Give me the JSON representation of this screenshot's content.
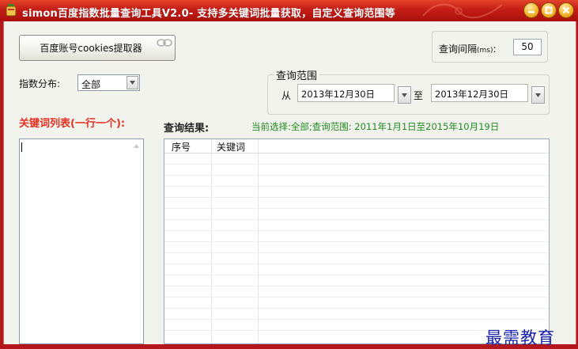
{
  "window": {
    "title": "simon百度指数批量查询工具V2.0- 支持多关键词批量获取，自定义查询范围等",
    "icons": {
      "app": "app-icon",
      "minimize": "minimize-icon",
      "maximize": "maximize-icon",
      "close": "close-icon"
    },
    "colors": {
      "title_bar": "#c31d16",
      "window_buttons": "#f4b52e",
      "client_bg": "#f3f3ee"
    }
  },
  "toolbar": {
    "cookies_button": "百度账号cookies提取器"
  },
  "interval": {
    "label": "查询间隔",
    "unit": "(ms)",
    "value": "50"
  },
  "distribution": {
    "label": "指数分布:",
    "selected": "全部"
  },
  "range": {
    "title": "查询范围",
    "from_label": "从",
    "to_label": "至",
    "start_date": "2013年12月30日",
    "end_date": "2013年12月30日"
  },
  "keywords": {
    "label": "关键词列表(一行一个):",
    "value": "",
    "label_color": "#e53121"
  },
  "results": {
    "label": "查询结果:",
    "status": "当前选择:全部;查询范围: 2011年1月1日至2015年10月19日",
    "status_color": "#1e8a1e",
    "columns": [
      "序号",
      "关键词"
    ],
    "rows": []
  },
  "watermark": {
    "text": "最需教育",
    "color": "#1a23a8"
  }
}
